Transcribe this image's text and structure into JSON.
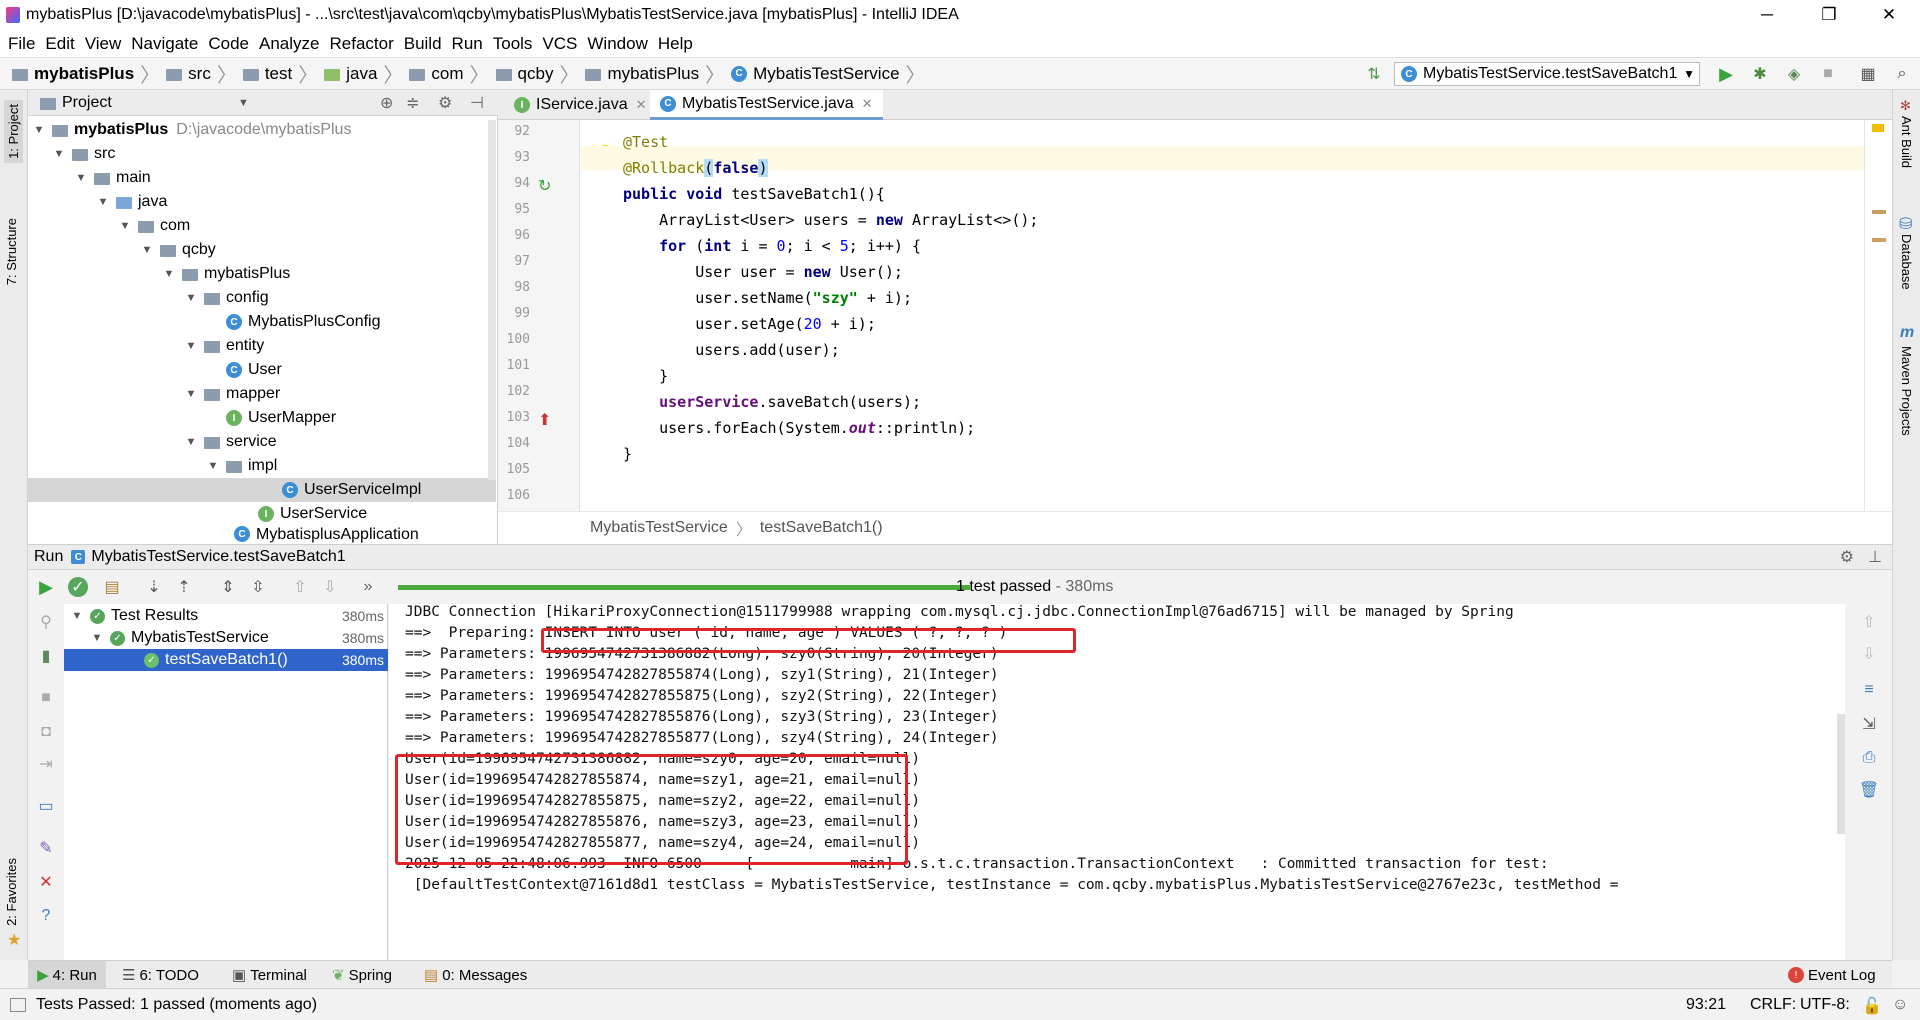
{
  "titlebar": {
    "title": "mybatisPlus [D:\\javacode\\mybatisPlus] - ...\\src\\test\\java\\com\\qcby\\mybatisPlus\\MybatisTestService.java [mybatisPlus] - IntelliJ IDEA"
  },
  "menu": [
    "File",
    "Edit",
    "View",
    "Navigate",
    "Code",
    "Analyze",
    "Refactor",
    "Build",
    "Run",
    "Tools",
    "VCS",
    "Window",
    "Help"
  ],
  "breadcrumb": [
    "mybatisPlus",
    "src",
    "test",
    "java",
    "com",
    "qcby",
    "mybatisPlus",
    "MybatisTestService"
  ],
  "run_config": "MybatisTestService.testSaveBatch1",
  "left_strip": {
    "project": "1: Project",
    "structure": "7: Structure",
    "favorites": "2: Favorites"
  },
  "right_strip": {
    "ant": "Ant Build",
    "database": "Database",
    "maven": "Maven Projects"
  },
  "project_panel": {
    "header": "Project",
    "root_name": "mybatisPlus",
    "root_path": "D:\\javacode\\mybatisPlus",
    "nodes": [
      "src",
      "main",
      "java",
      "com",
      "qcby",
      "mybatisPlus",
      "config",
      "MybatisPlusConfig",
      "entity",
      "User",
      "mapper",
      "UserMapper",
      "service",
      "impl",
      "UserServiceImpl",
      "UserService",
      "MybatisplusApplication"
    ]
  },
  "editor": {
    "tabs": [
      "IService.java",
      "MybatisTestService.java"
    ],
    "line_numbers": [
      "92",
      "93",
      "94",
      "95",
      "96",
      "97",
      "98",
      "99",
      "100",
      "101",
      "102",
      "103",
      "104",
      "105",
      "106"
    ],
    "breadcrumb": [
      "MybatisTestService",
      "testSaveBatch1()"
    ]
  },
  "run": {
    "header_label": "Run",
    "config": "MybatisTestService.testSaveBatch1",
    "status": "1 test passed",
    "status_time": "- 380ms",
    "progress": 1.0,
    "tree": [
      {
        "label": "Test Results",
        "time": "380ms"
      },
      {
        "label": "MybatisTestService",
        "time": "380ms"
      },
      {
        "label": "testSaveBatch1()",
        "time": "380ms"
      }
    ],
    "console": [
      "JDBC Connection [HikariProxyConnection@1511799988 wrapping com.mysql.cj.jdbc.ConnectionImpl@76ad6715] will be managed by Spring",
      "==>  Preparing: INSERT INTO user ( id, name, age ) VALUES ( ?, ?, ? )",
      "==> Parameters: 1996954742731386882(Long), szy0(String), 20(Integer)",
      "==> Parameters: 1996954742827855874(Long), szy1(String), 21(Integer)",
      "==> Parameters: 1996954742827855875(Long), szy2(String), 22(Integer)",
      "==> Parameters: 1996954742827855876(Long), szy3(String), 23(Integer)",
      "==> Parameters: 1996954742827855877(Long), szy4(String), 24(Integer)",
      "User(id=1996954742731386882, name=szy0, age=20, email=null)",
      "User(id=1996954742827855874, name=szy1, age=21, email=null)",
      "User(id=1996954742827855875, name=szy2, age=22, email=null)",
      "User(id=1996954742827855876, name=szy3, age=23, email=null)",
      "User(id=1996954742827855877, name=szy4, age=24, email=null)",
      "2025-12-05 22:48:06.993  INFO 6500 --- [           main] o.s.t.c.transaction.TransactionContext   : Committed transaction for test:",
      " [DefaultTestContext@7161d8d1 testClass = MybatisTestService, testInstance = com.qcby.mybatisPlus.MybatisTestService@2767e23c, testMethod ="
    ]
  },
  "bottom_tabs": [
    "4: Run",
    "6: TODO",
    "Terminal",
    "Spring",
    "0: Messages",
    "Event Log"
  ],
  "statusbar": {
    "message": "Tests Passed: 1 passed (moments ago)",
    "position": "93:21",
    "line_sep": "CRLF:",
    "encoding": "UTF-8:"
  },
  "colors": {
    "accent": "#2f65ca",
    "highlight_box": "#e0242a",
    "success": "#58a55c"
  }
}
